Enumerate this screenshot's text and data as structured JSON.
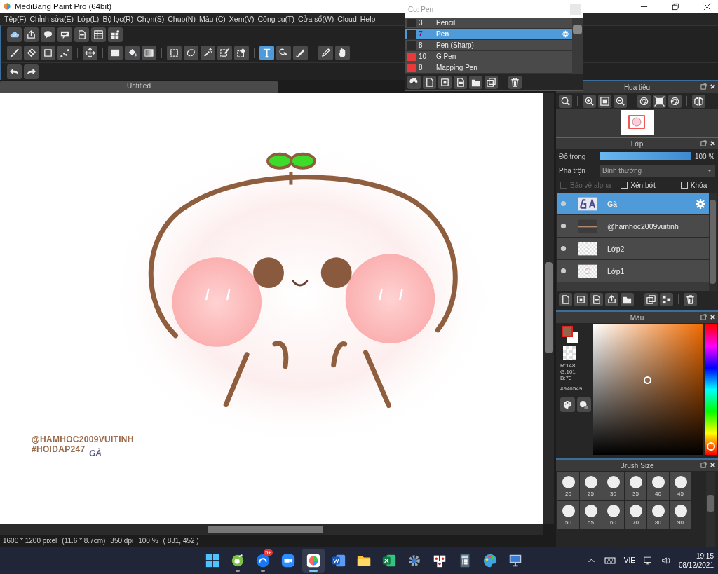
{
  "window": {
    "title": "MediBang Paint Pro (64bit)"
  },
  "menu": [
    "Tệp(F)",
    "Chỉnh sửa(E)",
    "Lớp(L)",
    "Bộ lọc(R)",
    "Chọn(S)",
    "Chụp(N)",
    "Màu (C)",
    "Xem(V)",
    "Công cụ(T)",
    "Cửa sổ(W)",
    "Cloud",
    "Help"
  ],
  "toolbars": [
    [
      [
        {
          "kind": "cloud",
          "selected": false
        },
        {
          "kind": "share",
          "selected": false
        },
        {
          "kind": "speech",
          "selected": false
        },
        {
          "kind": "comment",
          "selected": false
        },
        {
          "kind": "page",
          "selected": false
        },
        {
          "kind": "list",
          "selected": false
        },
        {
          "kind": "grid",
          "selected": false
        }
      ]
    ],
    [
      [
        {
          "kind": "brush",
          "selected": false
        },
        {
          "kind": "eraser",
          "selected": false
        },
        {
          "kind": "square",
          "selected": false
        },
        {
          "kind": "dots",
          "selected": false
        }
      ],
      [
        {
          "kind": "move",
          "selected": false
        }
      ],
      [
        {
          "kind": "filled-square",
          "selected": false
        },
        {
          "kind": "bucket",
          "selected": false
        },
        {
          "kind": "gradient",
          "selected": false
        }
      ],
      [
        {
          "kind": "dashed-rect",
          "selected": false
        },
        {
          "kind": "lasso",
          "selected": false
        },
        {
          "kind": "wand",
          "selected": false
        },
        {
          "kind": "pen-select",
          "selected": false
        },
        {
          "kind": "eraser-select",
          "selected": false
        }
      ],
      [
        {
          "kind": "text",
          "selected": true
        },
        {
          "kind": "pointer",
          "selected": false
        },
        {
          "kind": "blade",
          "selected": false
        }
      ],
      [
        {
          "kind": "eyedropper",
          "selected": false
        },
        {
          "kind": "hand",
          "selected": false
        }
      ]
    ],
    [
      [
        {
          "kind": "undo",
          "selected": false
        },
        {
          "kind": "redo",
          "selected": false
        }
      ]
    ]
  ],
  "document_tab": {
    "label": "Untitled"
  },
  "canvas": {
    "texts": [
      {
        "kind": "handle",
        "text": "@HAMHOC2009VUITINH"
      },
      {
        "kind": "handle",
        "text": "#HOIDAP247"
      },
      {
        "kind": "signature",
        "text": "GÀ"
      }
    ]
  },
  "status_bar": [
    "1600 * 1200 pixel",
    "(11.6 * 8.7cm)",
    "350 dpi",
    "100 %",
    "( 831, 452 )"
  ],
  "brush_popup": {
    "title": "Cọ: Pen",
    "brushes": [
      {
        "size": "3",
        "name": "Pencil",
        "color": "#2b2b2b",
        "selected": false
      },
      {
        "size": "7",
        "name": "Pen",
        "color": "#2b2b2b",
        "selected": true
      },
      {
        "size": "8",
        "name": "Pen (Sharp)",
        "color": "#2b2b2b",
        "selected": false
      },
      {
        "size": "10",
        "name": "G Pen",
        "color": "#e83a3a",
        "selected": false
      },
      {
        "size": "8",
        "name": "Mapping Pen",
        "color": "#e83a3a",
        "selected": false
      }
    ]
  },
  "navigator": {
    "title": "Hoa tiêu"
  },
  "layers": {
    "title": "Lớp",
    "opacity": {
      "label": "Độ trong",
      "level": 1,
      "reading": "100 %"
    },
    "blend": {
      "label": "Pha trộn",
      "value": "Bình thường"
    },
    "options": [
      {
        "label": "Bảo vệ alpha",
        "checked": false,
        "disabled": true
      },
      {
        "label": "Xén bớt",
        "checked": false,
        "disabled": false
      },
      {
        "label": "Khóa",
        "checked": false,
        "disabled": false
      }
    ],
    "items": [
      {
        "name": "Gà",
        "kind": "lettering",
        "selected": true
      },
      {
        "name": "@hamhoc2009vuitinh",
        "kind": "strip",
        "selected": false
      },
      {
        "name": "Lớp2",
        "kind": "blank",
        "selected": false
      },
      {
        "name": "Lớp1",
        "kind": "sketch",
        "selected": false
      }
    ]
  },
  "color": {
    "title": "Màu",
    "rgb": [
      "R:148",
      "G:101",
      "B:73"
    ],
    "hex": "#946549",
    "hue": {
      "level": 0.03
    }
  },
  "brush_size": {
    "title": "Brush Size",
    "sizes": [
      "20",
      "25",
      "30",
      "35",
      "40",
      "45",
      "50",
      "55",
      "60",
      "70",
      "80",
      "90"
    ]
  },
  "taskbar": {
    "apps": [
      {
        "kind": "start",
        "running": false,
        "active": false
      },
      {
        "kind": "green",
        "running": true,
        "active": false
      },
      {
        "kind": "chat",
        "running": true,
        "active": false,
        "badge": "5+"
      },
      {
        "kind": "video",
        "running": false,
        "active": false
      },
      {
        "kind": "paint",
        "running": true,
        "active": true
      },
      {
        "kind": "doc",
        "running": false,
        "active": false
      },
      {
        "kind": "folder",
        "running": false,
        "active": false
      },
      {
        "kind": "sheet",
        "running": false,
        "active": false
      },
      {
        "kind": "gear",
        "running": false,
        "active": false
      },
      {
        "kind": "cards",
        "running": false,
        "active": false
      },
      {
        "kind": "calc",
        "running": false,
        "active": false
      },
      {
        "kind": "palette",
        "running": false,
        "active": false
      },
      {
        "kind": "monitor",
        "running": false,
        "active": false
      }
    ],
    "tray": {
      "language": "VIE",
      "time": "19:15",
      "date": "08/12/2021"
    }
  }
}
